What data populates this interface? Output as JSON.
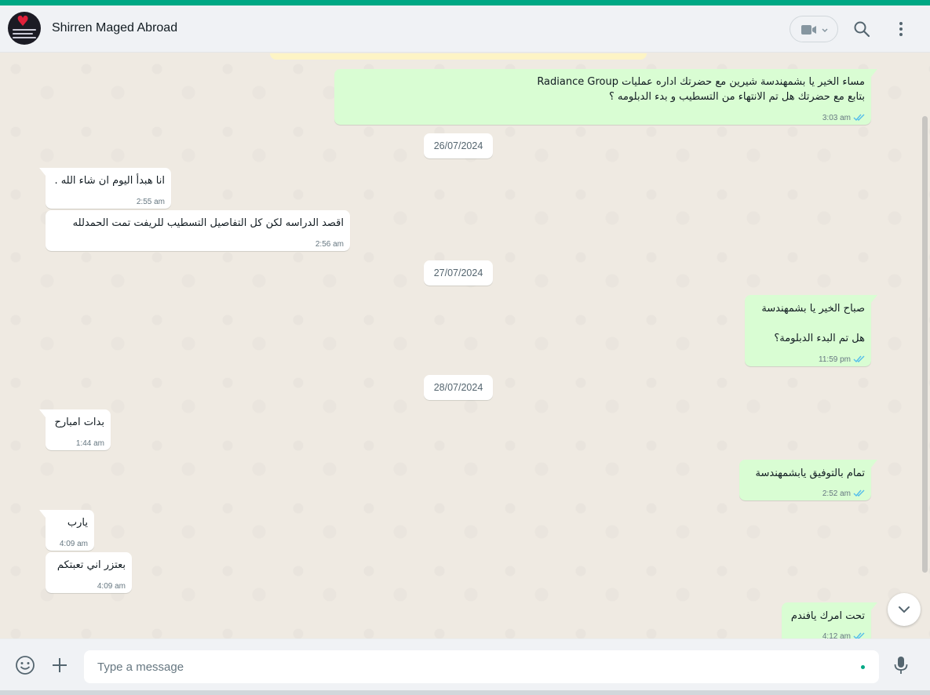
{
  "contact": {
    "name": "Shirren Maged Abroad"
  },
  "header_icons": [
    "video-call-icon",
    "search-icon",
    "menu-icon"
  ],
  "colors": {
    "accent": "#00a884",
    "outgoing_bubble": "#d9fdd3",
    "incoming_bubble": "#ffffff",
    "chat_background": "#efeae2",
    "read_ticks": "#53bdeb"
  },
  "dates": [
    "26/07/2024",
    "27/07/2024",
    "28/07/2024"
  ],
  "messages": [
    {
      "direction": "outgoing",
      "lines": [
        "مساء الخير يا بشمهندسة شيرين مع  حضرتك اداره عمليات Radiance Group",
        "بتابع مع حضرتك هل تم الانتهاء من التسطيب و بدء الدبلومه ؟"
      ],
      "time": "3:03 am",
      "status": "read"
    },
    {
      "direction": "incoming",
      "lines": [
        "انا هبدأ اليوم ان شاء الله ."
      ],
      "time": "2:55 am"
    },
    {
      "direction": "incoming",
      "lines": [
        "اقصد الدراسه  لكن  كل التفاصيل التسطيب للريفت تمت الحمدلله"
      ],
      "time": "2:56 am"
    },
    {
      "direction": "outgoing",
      "lines": [
        "صباح الخير يا بشمهندسة",
        "",
        "هل تم البدء الدبلومة؟"
      ],
      "time": "11:59 pm",
      "status": "read"
    },
    {
      "direction": "incoming",
      "lines": [
        "بدات امبارح"
      ],
      "time": "1:44 am"
    },
    {
      "direction": "outgoing",
      "lines": [
        "تمام بالتوفيق يابشمهندسة"
      ],
      "time": "2:52 am",
      "status": "read"
    },
    {
      "direction": "incoming",
      "lines": [
        "يارب"
      ],
      "time": "4:09 am"
    },
    {
      "direction": "incoming",
      "lines": [
        "بعتزر اني تعبتكم"
      ],
      "time": "4:09 am"
    },
    {
      "direction": "outgoing",
      "lines": [
        "تحت امرك يافندم"
      ],
      "time": "4:12 am",
      "status": "read"
    }
  ],
  "composer": {
    "placeholder": "Type a message"
  },
  "footer_icons": [
    "emoji-icon",
    "attach-plus-icon",
    "microphone-icon"
  ]
}
